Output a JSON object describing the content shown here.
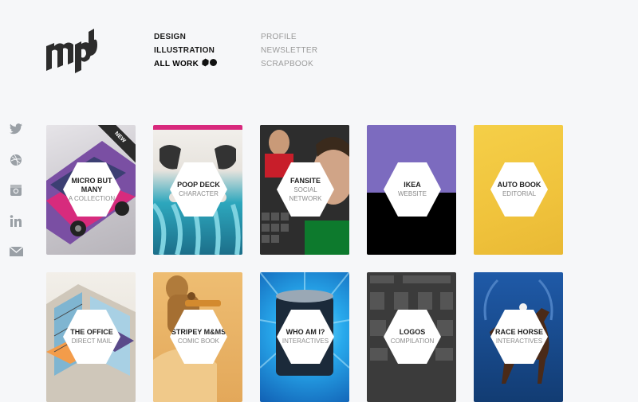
{
  "brand": {
    "logo_text": "mpb"
  },
  "nav": {
    "primary": [
      {
        "label": "DESIGN"
      },
      {
        "label": "ILLUSTRATION"
      },
      {
        "label": "ALL WORK"
      }
    ],
    "secondary": [
      {
        "label": "PROFILE"
      },
      {
        "label": "NEWSLETTER"
      },
      {
        "label": "SCRAPBOOK"
      }
    ]
  },
  "social": [
    "twitter-icon",
    "dribbble-icon",
    "instagram-icon",
    "linkedin-icon",
    "mail-icon"
  ],
  "tiles": [
    {
      "title": "MICRO BUT MANY",
      "subtitle": "A COLLECTION",
      "badge": "NEW",
      "color": "#c9c7cc"
    },
    {
      "title": "POOP DECK",
      "subtitle": "CHARACTER",
      "color": "#3fb6c9"
    },
    {
      "title": "FANSITE",
      "subtitle": "SOCIAL NETWORK",
      "color": "#2e8c3c"
    },
    {
      "title": "IKEA",
      "subtitle": "WEBSITE",
      "color": "#7c6bbf"
    },
    {
      "title": "AUTO BOOK",
      "subtitle": "EDITORIAL",
      "color": "#f3c93e"
    },
    {
      "title": "THE OFFICE",
      "subtitle": "DIRECT MAIL",
      "color": "#e7e4e1"
    },
    {
      "title": "STRIPEY M&MS",
      "subtitle": "COMIC BOOK",
      "color": "#e8b46a"
    },
    {
      "title": "WHO AM I?",
      "subtitle": "INTERACTIVES",
      "color": "#1f8fd6"
    },
    {
      "title": "LOGOS",
      "subtitle": "COMPILATION",
      "color": "#3b3b3b"
    },
    {
      "title": "RACE HORSE",
      "subtitle": "INTERACTIVES",
      "color": "#1b4f94"
    }
  ]
}
